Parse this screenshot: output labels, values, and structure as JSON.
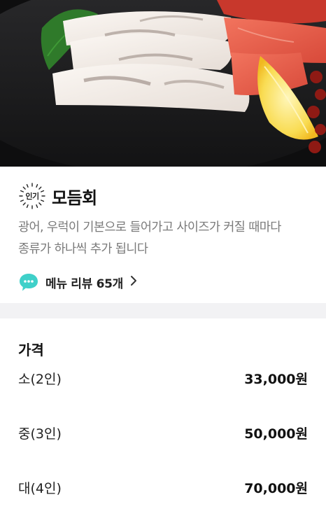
{
  "hero": {
    "image_alt": "sashimi platter",
    "icon": "sashimi-photo"
  },
  "menu": {
    "badge": "인기",
    "title": "모듬회",
    "description": "광어, 우럭이 기본으로 들어가고 사이즈가 커질 때마다 종류가 하나씩 추가 됩니다",
    "review_label": "메뉴 리뷰 65개",
    "review_icon": "chat-bubble-icon",
    "review_icon_color": "#3fd0c9"
  },
  "price": {
    "header": "가격",
    "options": [
      {
        "size": "소(2인)",
        "price": "33,000원"
      },
      {
        "size": "중(3인)",
        "price": "50,000원"
      },
      {
        "size": "대(4인)",
        "price": "70,000원"
      }
    ]
  },
  "colors": {
    "divider": "#f2f2f4",
    "description_text": "#7a7a7a",
    "accent_mint": "#3fd0c9"
  }
}
